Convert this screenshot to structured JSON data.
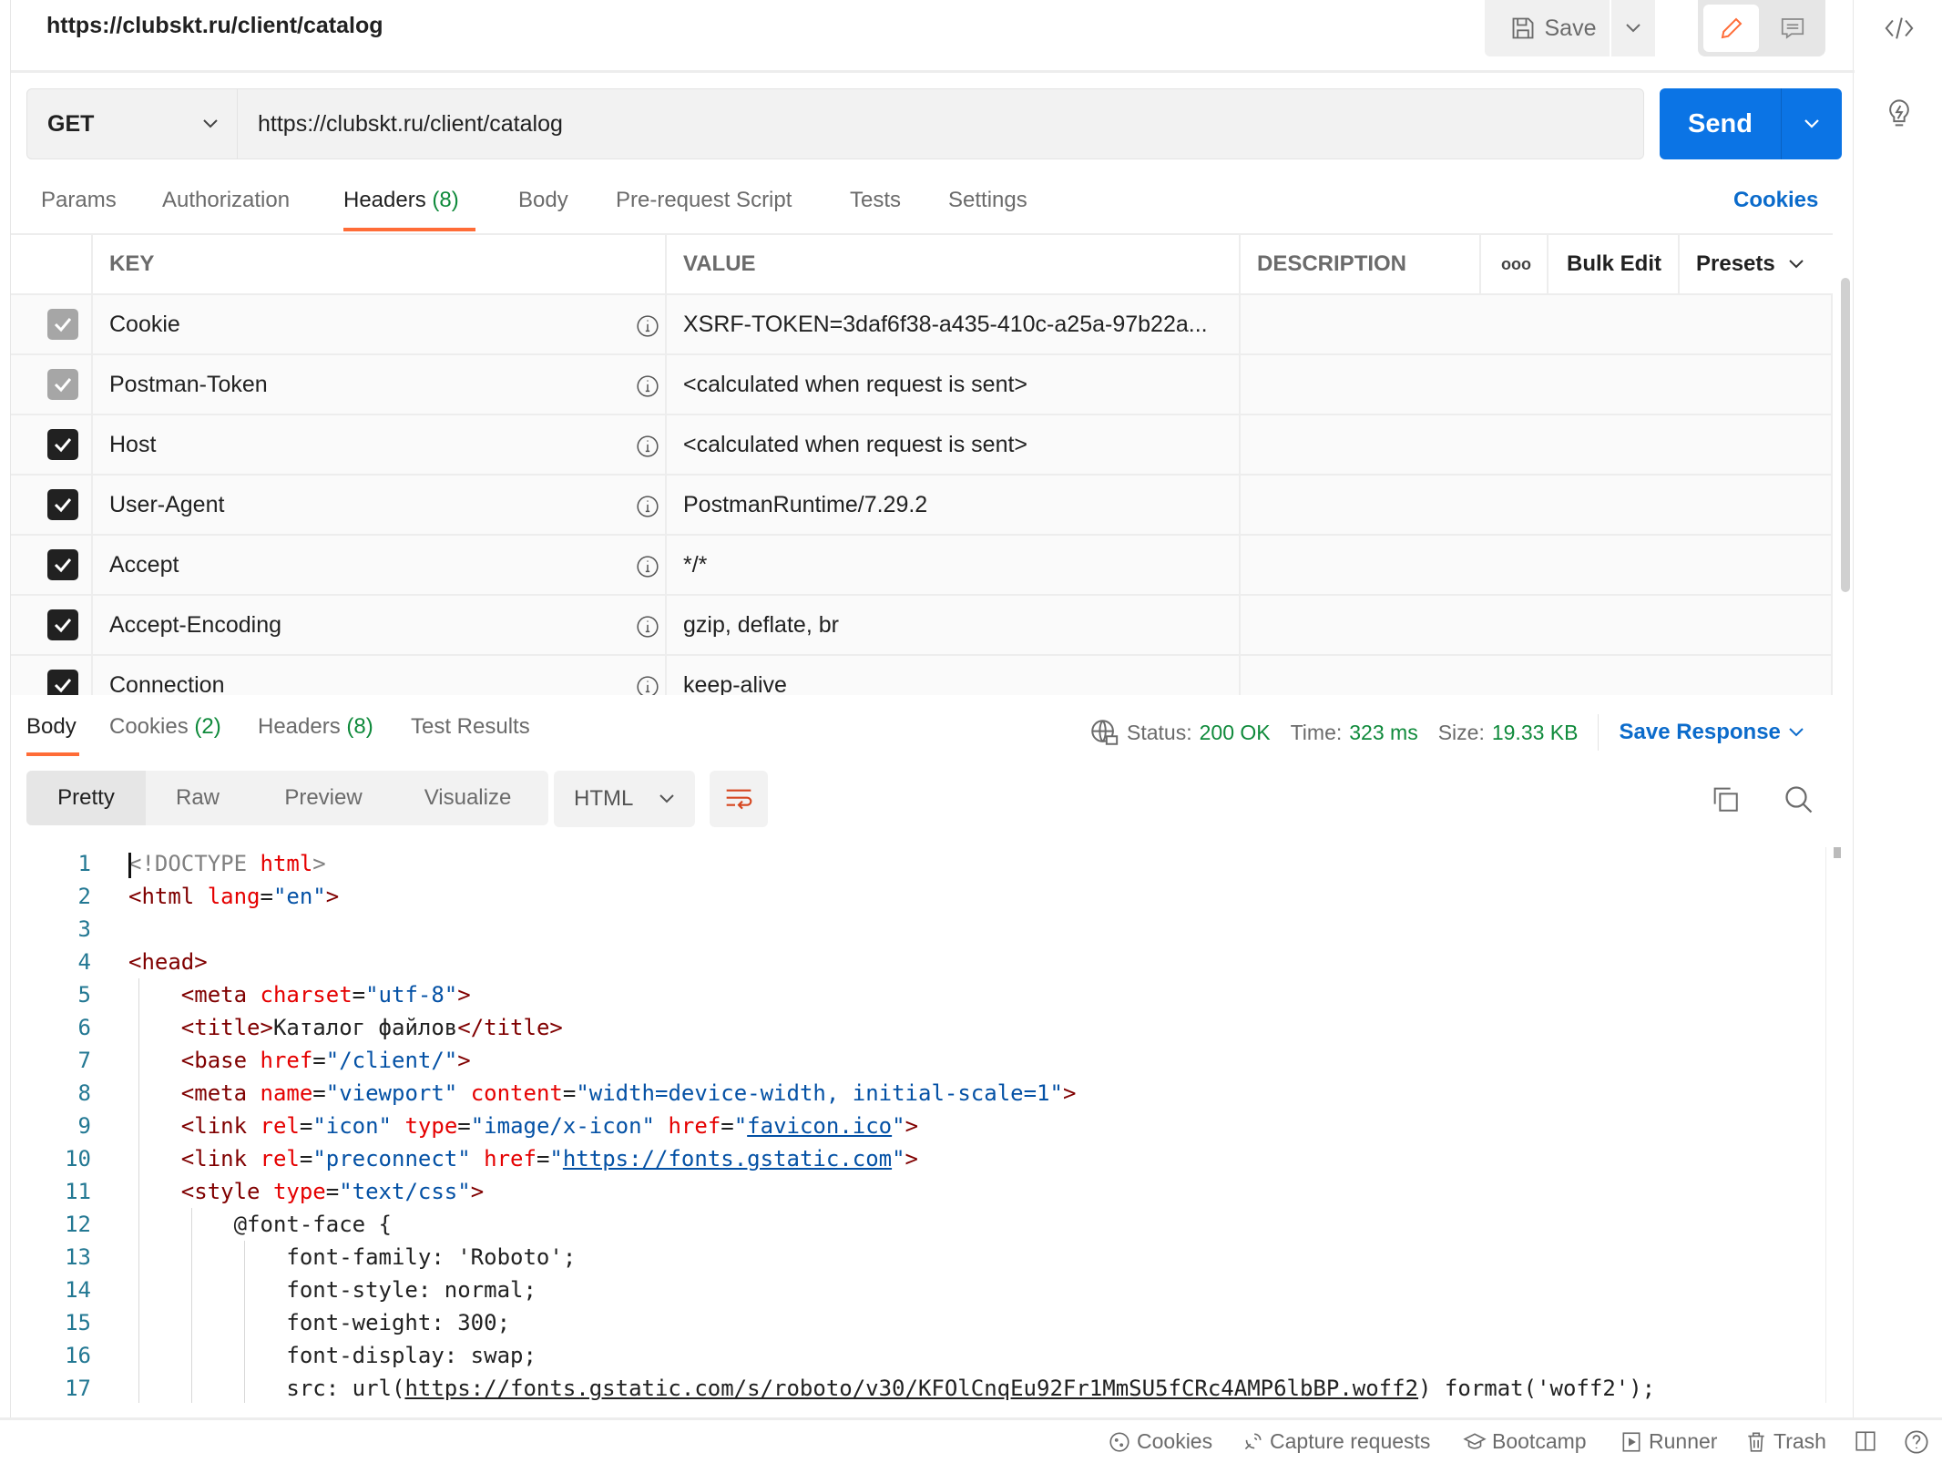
{
  "header": {
    "title": "https://clubskt.ru/client/catalog",
    "save_label": "Save"
  },
  "request": {
    "method": "GET",
    "url": "https://clubskt.ru/client/catalog",
    "send_label": "Send"
  },
  "request_tabs": [
    {
      "label": "Params"
    },
    {
      "label": "Authorization"
    },
    {
      "label": "Headers",
      "count": "(8)"
    },
    {
      "label": "Body"
    },
    {
      "label": "Pre-request Script"
    },
    {
      "label": "Tests"
    },
    {
      "label": "Settings"
    }
  ],
  "cookies_link": "Cookies",
  "headers_table": {
    "columns": {
      "key": "KEY",
      "value": "VALUE",
      "description": "DESCRIPTION",
      "more": "ooo",
      "bulk_edit": "Bulk Edit",
      "presets": "Presets"
    },
    "rows": [
      {
        "checked": true,
        "auto": true,
        "key": "Cookie",
        "value": "XSRF-TOKEN=3daf6f38-a435-410c-a25a-97b22a..."
      },
      {
        "checked": true,
        "auto": true,
        "key": "Postman-Token",
        "value": "<calculated when request is sent>"
      },
      {
        "checked": true,
        "auto": false,
        "key": "Host",
        "value": "<calculated when request is sent>"
      },
      {
        "checked": true,
        "auto": false,
        "key": "User-Agent",
        "value": "PostmanRuntime/7.29.2"
      },
      {
        "checked": true,
        "auto": false,
        "key": "Accept",
        "value": "*/*"
      },
      {
        "checked": true,
        "auto": false,
        "key": "Accept-Encoding",
        "value": "gzip, deflate, br"
      },
      {
        "checked": true,
        "auto": false,
        "key": "Connection",
        "value": "keep-alive"
      }
    ]
  },
  "response_tabs": [
    {
      "label": "Body"
    },
    {
      "label": "Cookies",
      "count": "(2)"
    },
    {
      "label": "Headers",
      "count": "(8)"
    },
    {
      "label": "Test Results"
    }
  ],
  "response_meta": {
    "status_label": "Status:",
    "status": "200 OK",
    "time_label": "Time:",
    "time": "323 ms",
    "size_label": "Size:",
    "size": "19.33 KB",
    "save_response": "Save Response"
  },
  "view_modes": [
    "Pretty",
    "Raw",
    "Preview",
    "Visualize"
  ],
  "active_view": "Pretty",
  "format": "HTML",
  "colors": {
    "accent": "#ff6c37",
    "send": "#0b74e5",
    "status_green": "#0f8a3b",
    "link_blue": "#0b6bcb"
  },
  "code_lines": [
    [
      [
        "gray",
        "<!DOCTYPE "
      ],
      [
        "attr",
        "html"
      ],
      [
        "gray",
        ">"
      ]
    ],
    [
      [
        "tag",
        "<html "
      ],
      [
        "attr",
        "lang"
      ],
      [
        "plain",
        "="
      ],
      [
        "val",
        "\"en\""
      ],
      [
        "tag",
        ">"
      ]
    ],
    [],
    [
      [
        "tag",
        "<head>"
      ]
    ],
    [
      [
        "plain",
        "    "
      ],
      [
        "tag",
        "<meta "
      ],
      [
        "attr",
        "charset"
      ],
      [
        "plain",
        "="
      ],
      [
        "val",
        "\"utf-8\""
      ],
      [
        "tag",
        ">"
      ]
    ],
    [
      [
        "plain",
        "    "
      ],
      [
        "tag",
        "<title>"
      ],
      [
        "plain",
        "Каталог файлов"
      ],
      [
        "tag",
        "</title>"
      ]
    ],
    [
      [
        "plain",
        "    "
      ],
      [
        "tag",
        "<base "
      ],
      [
        "attr",
        "href"
      ],
      [
        "plain",
        "="
      ],
      [
        "val",
        "\"/client/\""
      ],
      [
        "tag",
        ">"
      ]
    ],
    [
      [
        "plain",
        "    "
      ],
      [
        "tag",
        "<meta "
      ],
      [
        "attr",
        "name"
      ],
      [
        "plain",
        "="
      ],
      [
        "val",
        "\"viewport\" "
      ],
      [
        "attr",
        "content"
      ],
      [
        "plain",
        "="
      ],
      [
        "val",
        "\"width=device-width, initial-scale=1\""
      ],
      [
        "tag",
        ">"
      ]
    ],
    [
      [
        "plain",
        "    "
      ],
      [
        "tag",
        "<link "
      ],
      [
        "attr",
        "rel"
      ],
      [
        "plain",
        "="
      ],
      [
        "val",
        "\"icon\" "
      ],
      [
        "attr",
        "type"
      ],
      [
        "plain",
        "="
      ],
      [
        "val",
        "\"image/x-icon\" "
      ],
      [
        "attr",
        "href"
      ],
      [
        "plain",
        "="
      ],
      [
        "val",
        "\""
      ],
      [
        "link",
        "favicon.ico"
      ],
      [
        "val",
        "\""
      ],
      [
        "tag",
        ">"
      ]
    ],
    [
      [
        "plain",
        "    "
      ],
      [
        "tag",
        "<link "
      ],
      [
        "attr",
        "rel"
      ],
      [
        "plain",
        "="
      ],
      [
        "val",
        "\"preconnect\" "
      ],
      [
        "attr",
        "href"
      ],
      [
        "plain",
        "="
      ],
      [
        "val",
        "\""
      ],
      [
        "link",
        "https://fonts.gstatic.com"
      ],
      [
        "val",
        "\""
      ],
      [
        "tag",
        ">"
      ]
    ],
    [
      [
        "plain",
        "    "
      ],
      [
        "tag",
        "<style "
      ],
      [
        "attr",
        "type"
      ],
      [
        "plain",
        "="
      ],
      [
        "val",
        "\"text/css\""
      ],
      [
        "tag",
        ">"
      ]
    ],
    [
      [
        "plain",
        "        @font-face {"
      ]
    ],
    [
      [
        "plain",
        "            font-family: 'Roboto';"
      ]
    ],
    [
      [
        "plain",
        "            font-style: normal;"
      ]
    ],
    [
      [
        "plain",
        "            font-weight: 300;"
      ]
    ],
    [
      [
        "plain",
        "            font-display: swap;"
      ]
    ],
    [
      [
        "plain",
        "            src: url("
      ],
      [
        "url",
        "https://fonts.gstatic.com/s/roboto/v30/KFOlCnqEu92Fr1MmSU5fCRc4AMP6lbBP.woff2"
      ],
      [
        "plain",
        ") format('woff2');"
      ]
    ]
  ],
  "footer": {
    "items": [
      {
        "icon": "cookie-icon",
        "label": "Cookies"
      },
      {
        "icon": "satellite-icon",
        "label": "Capture requests"
      },
      {
        "icon": "graduation-cap-icon",
        "label": "Bootcamp"
      },
      {
        "icon": "play-icon",
        "label": "Runner"
      },
      {
        "icon": "trash-icon",
        "label": "Trash"
      }
    ]
  }
}
